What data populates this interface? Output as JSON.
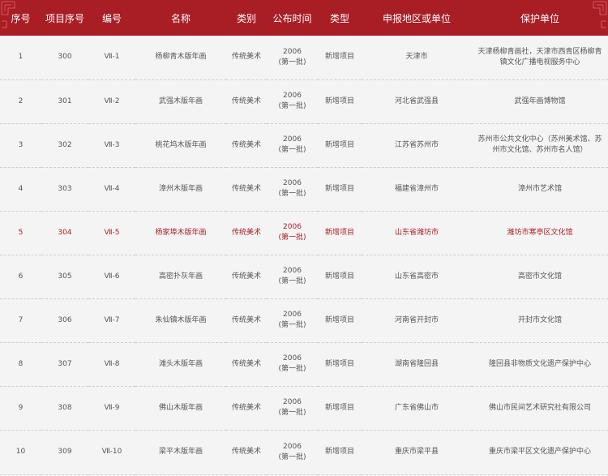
{
  "headers": [
    "序号",
    "项目序号",
    "编号",
    "名称",
    "类别",
    "公布时间",
    "类型",
    "申报地区或单位",
    "保护单位"
  ],
  "rows": [
    {
      "seq": "1",
      "proj": "300",
      "code": "Ⅶ-1",
      "name": "杨柳青木版年画",
      "cat": "传统美术",
      "year": "2006",
      "batch": "(第一批)",
      "type": "新增项目",
      "region": "天津市",
      "unit": "天津杨柳青画社，天津市西青区杨柳青镇文化广播电视服务中心"
    },
    {
      "seq": "2",
      "proj": "301",
      "code": "Ⅶ-2",
      "name": "武强木版年画",
      "cat": "传统美术",
      "year": "2006",
      "batch": "(第一批)",
      "type": "新增项目",
      "region": "河北省武强县",
      "unit": "武强年画博物馆"
    },
    {
      "seq": "3",
      "proj": "302",
      "code": "Ⅶ-3",
      "name": "桃花坞木版年画",
      "cat": "传统美术",
      "year": "2006",
      "batch": "(第一批)",
      "type": "新增项目",
      "region": "江苏省苏州市",
      "unit": "苏州市公共文化中心（苏州美术馆、苏州市文化馆、苏州市名人馆）"
    },
    {
      "seq": "4",
      "proj": "303",
      "code": "Ⅶ-4",
      "name": "漳州木版年画",
      "cat": "传统美术",
      "year": "2006",
      "batch": "(第一批)",
      "type": "新增项目",
      "region": "福建省漳州市",
      "unit": "漳州市艺术馆"
    },
    {
      "seq": "5",
      "proj": "304",
      "code": "Ⅶ-5",
      "name": "杨家埠木版年画",
      "cat": "传统美术",
      "year": "2006",
      "batch": "(第一批)",
      "type": "新增项目",
      "region": "山东省潍坊市",
      "unit": "潍坊市寒亭区文化馆"
    },
    {
      "seq": "6",
      "proj": "305",
      "code": "Ⅶ-6",
      "name": "高密扑灰年画",
      "cat": "传统美术",
      "year": "2006",
      "batch": "(第一批)",
      "type": "新增项目",
      "region": "山东省高密市",
      "unit": "高密市文化馆"
    },
    {
      "seq": "7",
      "proj": "306",
      "code": "Ⅶ-7",
      "name": "朱仙镇木版年画",
      "cat": "传统美术",
      "year": "2006",
      "batch": "(第一批)",
      "type": "新增项目",
      "region": "河南省开封市",
      "unit": "开封市文化馆"
    },
    {
      "seq": "8",
      "proj": "307",
      "code": "Ⅶ-8",
      "name": "滩头木版年画",
      "cat": "传统美术",
      "year": "2006",
      "batch": "(第一批)",
      "type": "新增项目",
      "region": "湖南省隆回县",
      "unit": "隆回县非物质文化遗产保护中心"
    },
    {
      "seq": "9",
      "proj": "308",
      "code": "Ⅶ-9",
      "name": "佛山木版年画",
      "cat": "传统美术",
      "year": "2006",
      "batch": "(第一批)",
      "type": "新增项目",
      "region": "广东省佛山市",
      "unit": "佛山市民间艺术研究社有限公司"
    },
    {
      "seq": "10",
      "proj": "309",
      "code": "Ⅶ-10",
      "name": "梁平木版年画",
      "cat": "传统美术",
      "year": "2006",
      "batch": "(第一批)",
      "type": "新增项目",
      "region": "重庆市梁平县",
      "unit": "重庆市梁平区文化遗产保护中心"
    }
  ],
  "highlight_row": 4,
  "colors": {
    "header_bg": "#a91d25",
    "highlight_text": "#a91d25",
    "page_bg": "#f4f4f4"
  }
}
